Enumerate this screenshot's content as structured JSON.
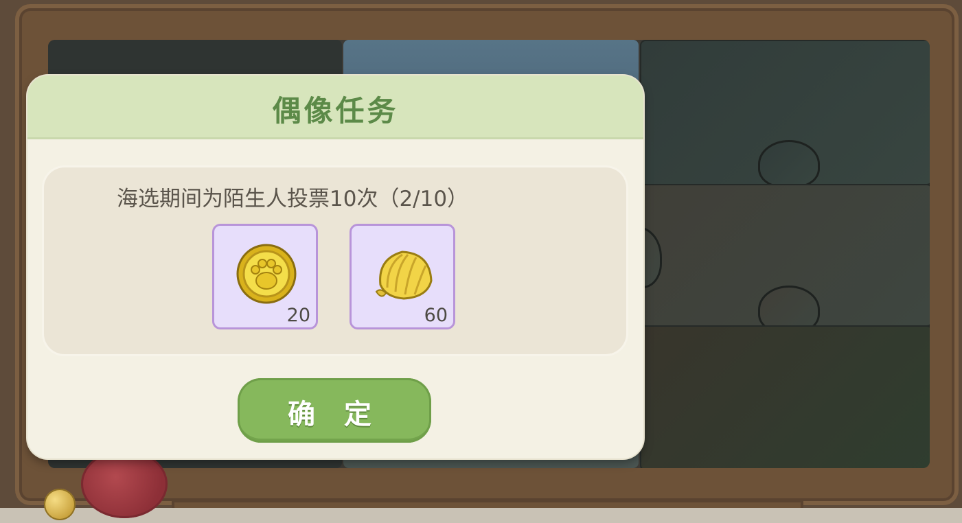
{
  "dialog": {
    "title": "偶像任务",
    "quest": {
      "description": "海选期间为陌生人投票10次（2/10）",
      "progress": {
        "current": 2,
        "total": 10
      }
    },
    "rewards": [
      {
        "icon": "paw-coin-icon",
        "quantity": "20"
      },
      {
        "icon": "golden-shell-icon",
        "quantity": "60"
      }
    ],
    "confirm_label": "确 定"
  },
  "colors": {
    "header": "#d7e5bc",
    "title": "#5c8a48",
    "confirm_button": "#86b85c",
    "reward_slot_bg": "#e7defb",
    "reward_slot_border": "#b894d9"
  }
}
